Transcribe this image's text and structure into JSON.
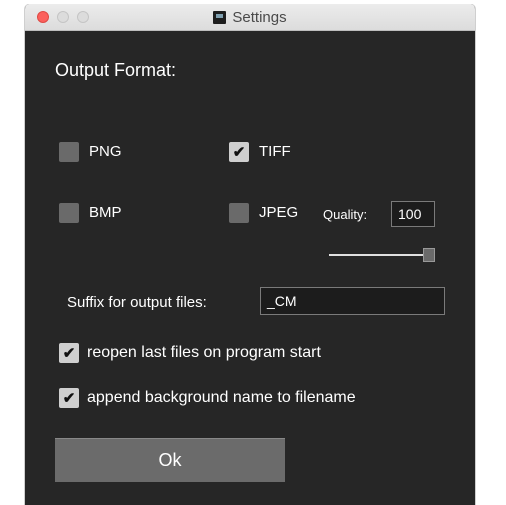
{
  "window": {
    "title": "Settings",
    "app_icon": "app-icon"
  },
  "output_format": {
    "heading": "Output Format:",
    "formats": [
      {
        "label": "PNG",
        "checked": false
      },
      {
        "label": "TIFF",
        "checked": true
      },
      {
        "label": "BMP",
        "checked": false
      },
      {
        "label": "JPEG",
        "checked": false
      }
    ],
    "quality_label": "Quality:",
    "quality_value": "100",
    "quality_slider_fraction": 1.0
  },
  "suffix": {
    "label": "Suffix for output files:",
    "value": "_CM"
  },
  "options": [
    {
      "label": "reopen last files on program start",
      "checked": true
    },
    {
      "label": "append background name to filename",
      "checked": true
    }
  ],
  "buttons": {
    "ok": "Ok"
  },
  "check_glyph": "✔"
}
